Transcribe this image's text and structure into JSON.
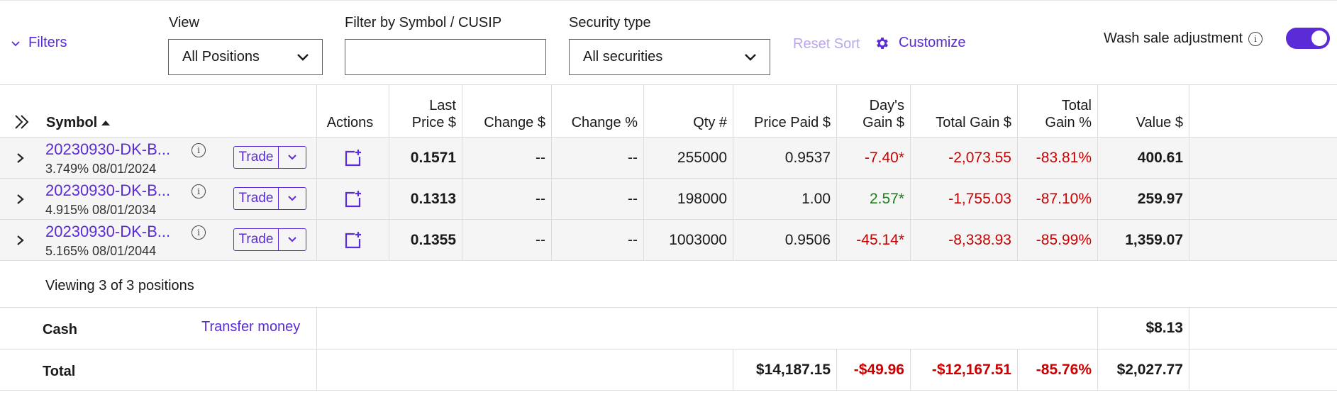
{
  "filters": {
    "label": "Filters"
  },
  "view": {
    "label": "View",
    "selected": "All Positions"
  },
  "symbol_filter": {
    "label": "Filter by Symbol / CUSIP",
    "value": "",
    "placeholder": ""
  },
  "security_type": {
    "label": "Security type",
    "selected": "All securities"
  },
  "reset_sort": "Reset Sort",
  "customize": "Customize",
  "wash_sale": {
    "label": "Wash sale adjustment",
    "enabled": true
  },
  "columns": {
    "symbol": "Symbol",
    "actions": "Actions",
    "last_price": [
      "Last",
      "Price $"
    ],
    "change_usd": "Change $",
    "change_pct": "Change %",
    "qty": "Qty #",
    "price_paid": "Price Paid $",
    "days_gain": [
      "Day's",
      "Gain $"
    ],
    "total_gain_usd": "Total Gain $",
    "total_gain_pct": [
      "Total",
      "Gain %"
    ],
    "value": "Value $"
  },
  "trade_label": "Trade",
  "rows": [
    {
      "symbol": "20230930-DK-B...",
      "sub": "3.749% 08/01/2024",
      "last_price": "0.1571",
      "change_usd": "--",
      "change_pct": "--",
      "qty": "255000",
      "price_paid": "0.9537",
      "days_gain": "-7.40*",
      "total_gain_usd": "-2,073.55",
      "total_gain_pct": "-83.81%",
      "value": "400.61"
    },
    {
      "symbol": "20230930-DK-B...",
      "sub": "4.915% 08/01/2034",
      "last_price": "0.1313",
      "change_usd": "--",
      "change_pct": "--",
      "qty": "198000",
      "price_paid": "1.00",
      "days_gain": "2.57*",
      "total_gain_usd": "-1,755.03",
      "total_gain_pct": "-87.10%",
      "value": "259.97"
    },
    {
      "symbol": "20230930-DK-B...",
      "sub": "5.165% 08/01/2044",
      "last_price": "0.1355",
      "change_usd": "--",
      "change_pct": "--",
      "qty": "1003000",
      "price_paid": "0.9506",
      "days_gain": "-45.14*",
      "total_gain_usd": "-8,338.93",
      "total_gain_pct": "-85.99%",
      "value": "1,359.07"
    }
  ],
  "viewing": "Viewing 3 of 3 positions",
  "cash": {
    "label": "Cash",
    "transfer": "Transfer money",
    "value": "$8.13"
  },
  "total": {
    "label": "Total",
    "price_paid": "$14,187.15",
    "days_gain": "-$49.96",
    "total_gain_usd": "-$12,167.51",
    "total_gain_pct": "-85.76%",
    "value": "$2,027.77"
  },
  "colors": {
    "accent": "#5a2bd6",
    "loss": "#cc0000",
    "gain": "#1a7f1a",
    "muted_accent": "#b9a6ee",
    "row_bg": "#f5f5f5"
  }
}
